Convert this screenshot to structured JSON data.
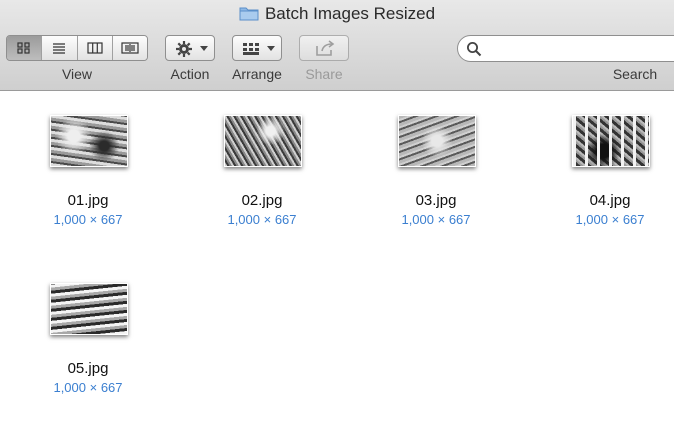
{
  "window": {
    "title": "Batch Images Resized"
  },
  "toolbar": {
    "view_label": "View",
    "action_label": "Action",
    "arrange_label": "Arrange",
    "share_label": "Share",
    "search_label": "Search",
    "search_placeholder": ""
  },
  "files": [
    {
      "name": "01.jpg",
      "dims": "1,000 × 667"
    },
    {
      "name": "02.jpg",
      "dims": "1,000 × 667"
    },
    {
      "name": "03.jpg",
      "dims": "1,000 × 667"
    },
    {
      "name": "04.jpg",
      "dims": "1,000 × 667"
    },
    {
      "name": "05.jpg",
      "dims": "1,000 × 667"
    }
  ],
  "colors": {
    "accent": "#3b7fd0",
    "toolbar_top": "#e8e8e8",
    "toolbar_bottom": "#cfcfcf"
  }
}
